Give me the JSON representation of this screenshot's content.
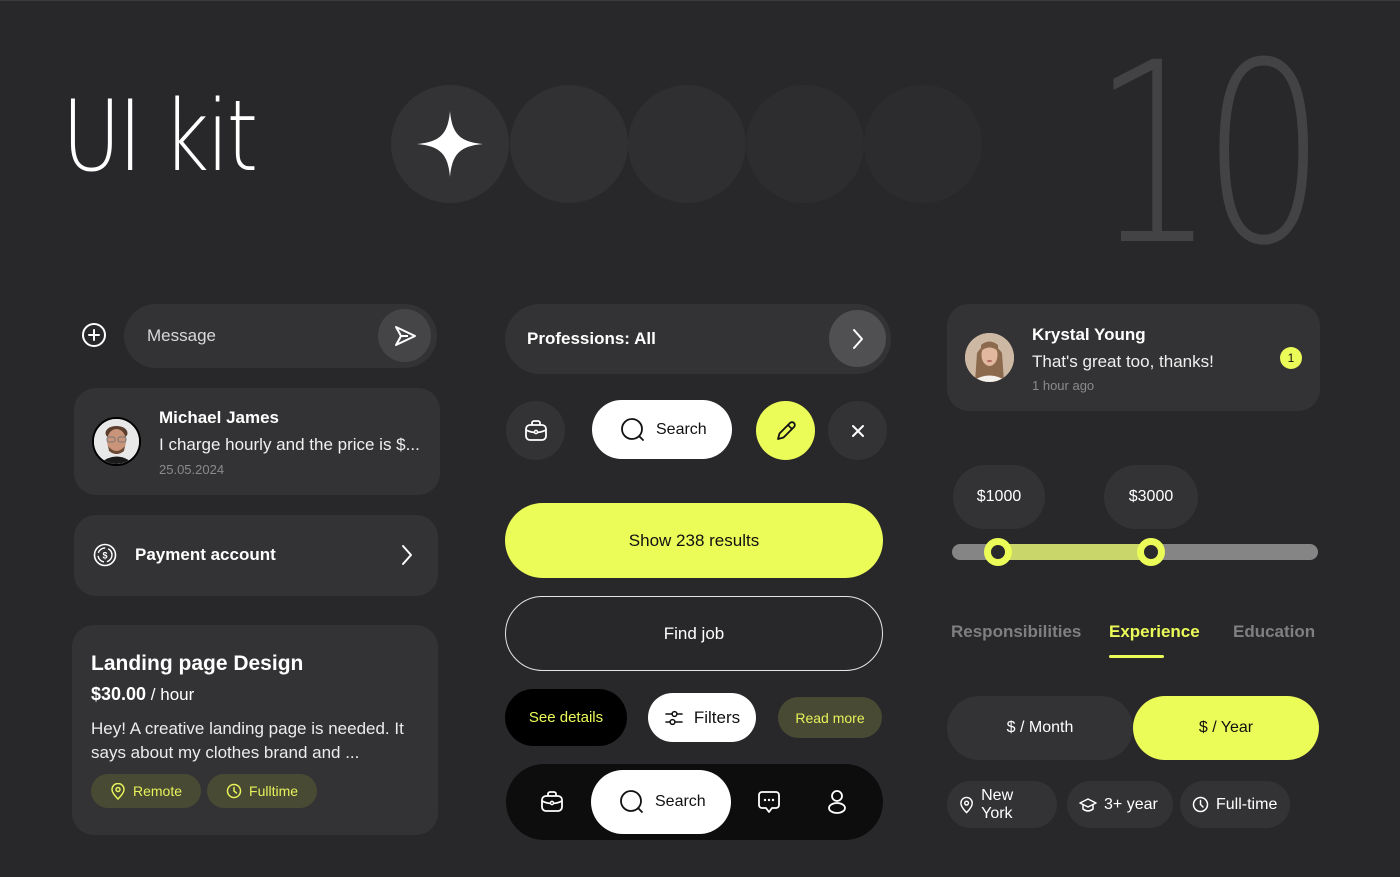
{
  "header": {
    "title": "UI kit",
    "number": "10",
    "circles": [
      "sparkle-icon",
      "",
      "",
      "",
      ""
    ]
  },
  "message_input": {
    "placeholder": "Message",
    "value": "",
    "add_icon": "plus-circle-icon",
    "send_icon": "send-icon"
  },
  "chat_card": {
    "name": "Michael James",
    "preview": "I charge hourly and the price is $...",
    "date": "25.05.2024"
  },
  "payment_account": {
    "label": "Payment account",
    "icon": "dollar-circle-icon",
    "chevron": "chevron-right-icon"
  },
  "job_card": {
    "title": "Landing page Design",
    "price": "$30.00",
    "unit": "/ hour",
    "description": "Hey! A creative landing page is needed. It says about my clothes brand and ...",
    "tags": [
      {
        "label": "Remote",
        "icon": "location-pin-icon"
      },
      {
        "label": "Fulltime",
        "icon": "clock-icon"
      }
    ]
  },
  "professions": {
    "label": "Professions: All"
  },
  "action_row": {
    "search_label": "Search"
  },
  "buttons": {
    "primary": "Show 238 results",
    "outline": "Find job",
    "see_details": "See details",
    "filters": "Filters",
    "read_more": "Read more"
  },
  "bottom_nav": {
    "items": [
      {
        "icon": "briefcase-icon"
      },
      {
        "icon": "search-icon",
        "label": "Search",
        "active": true
      },
      {
        "icon": "chat-icon"
      },
      {
        "icon": "user-icon"
      }
    ]
  },
  "notification": {
    "name": "Krystal Young",
    "message": "That's great too, thanks!",
    "time": "1 hour ago",
    "unread_count": "1"
  },
  "price_range": {
    "min_label": "$1000",
    "max_label": "$3000",
    "min_fraction": 0.125,
    "max_fraction": 0.545
  },
  "tabs": {
    "items": [
      "Responsibilities",
      "Experience",
      "Education"
    ],
    "active": "Experience"
  },
  "period_toggle": {
    "options": [
      "$ / Month",
      "$ / Year"
    ],
    "selected": "$ / Year"
  },
  "info_chips": [
    {
      "label": "New York",
      "icon": "location-pin-icon"
    },
    {
      "label": "3+ year",
      "icon": "graduation-cap-icon"
    },
    {
      "label": "Full-time",
      "icon": "clock-icon"
    }
  ],
  "colors": {
    "background": "#28282a",
    "surface": "#333335",
    "accent": "#ebfb58",
    "accent_muted_bg": "#484a34",
    "muted_text": "#7f7f81"
  }
}
